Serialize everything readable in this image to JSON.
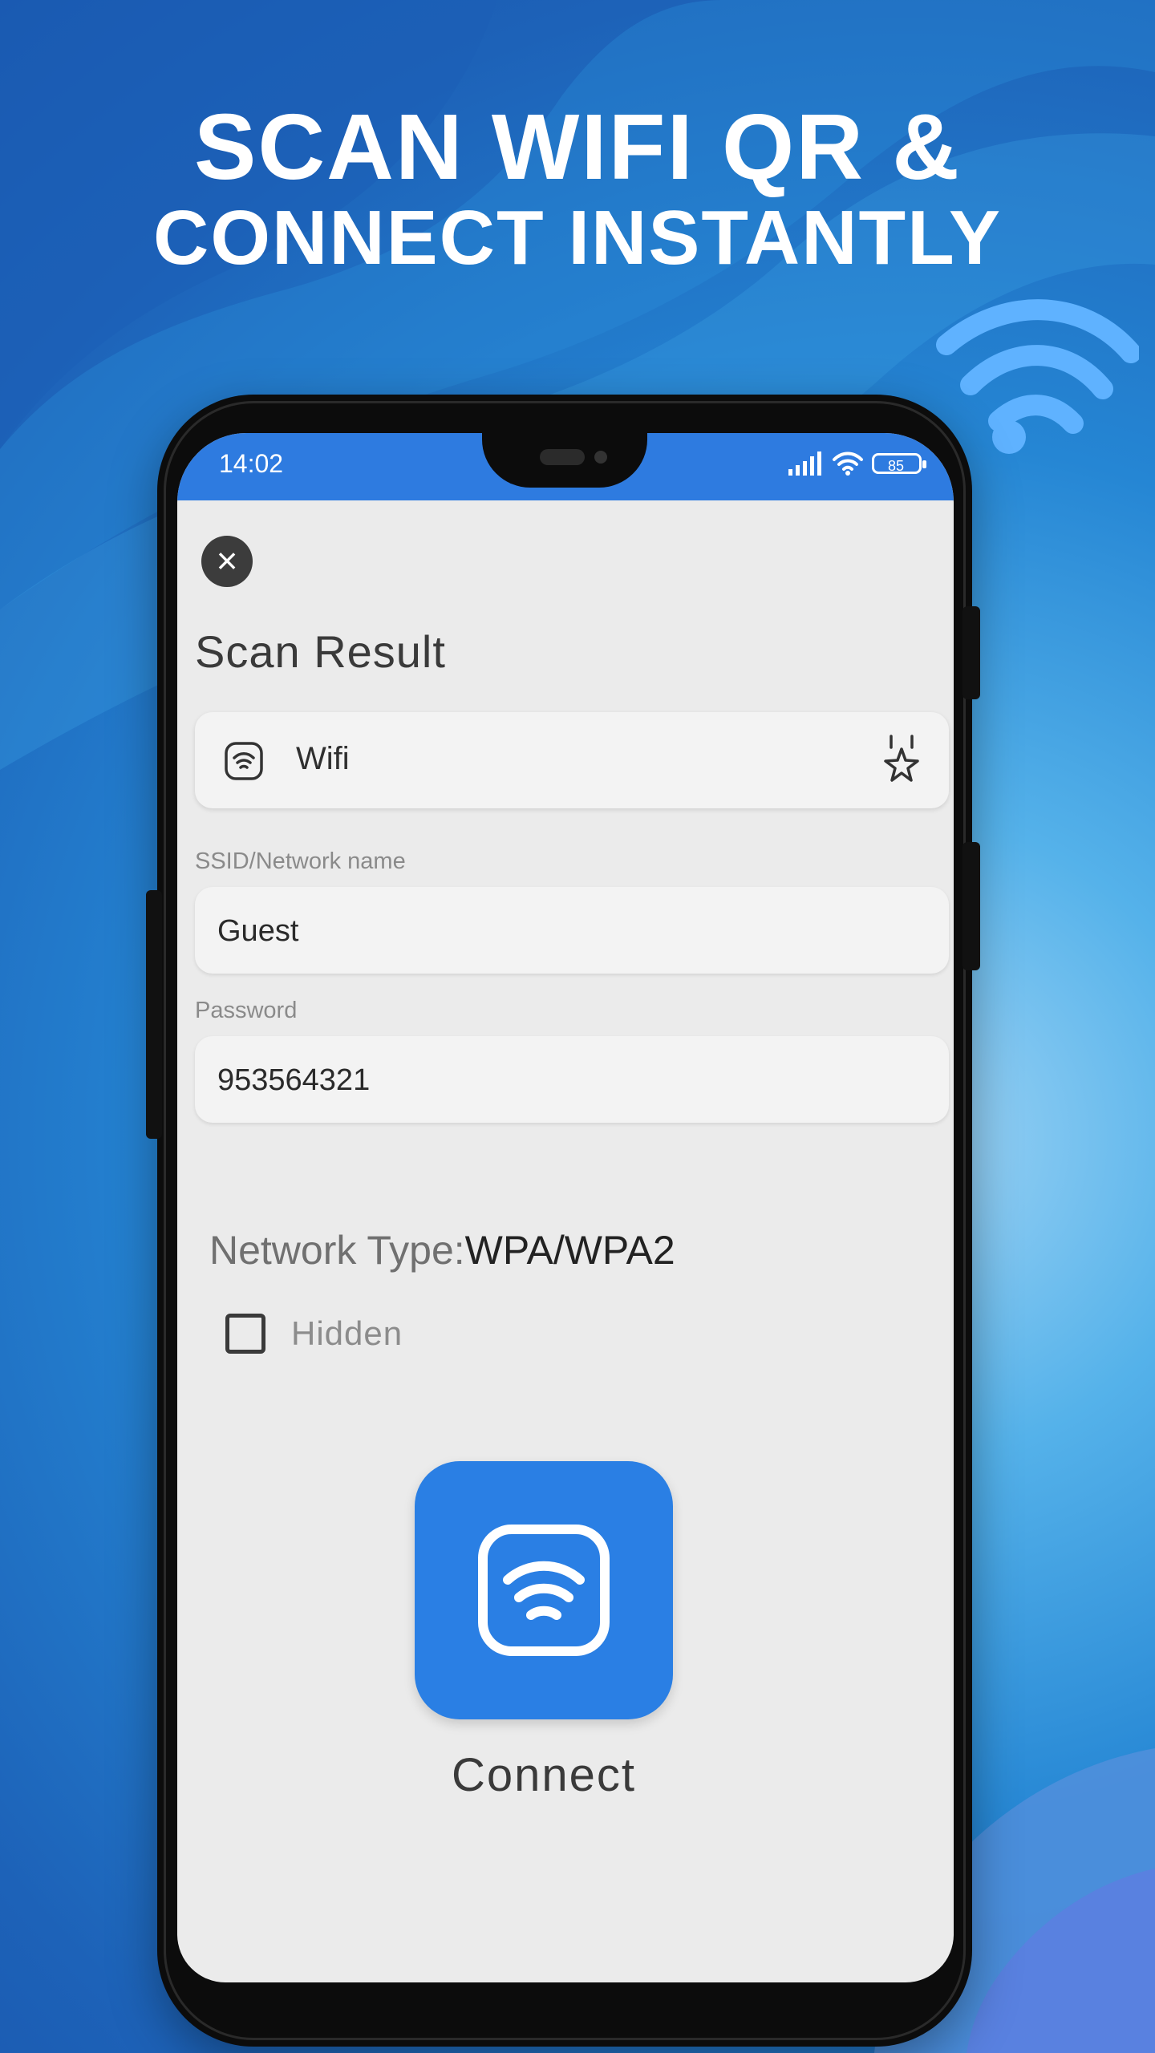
{
  "headline": {
    "line1": "SCAN WIFI QR &",
    "line2": "CONNECT INSTANTLY"
  },
  "statusbar": {
    "time": "14:02",
    "battery": "85"
  },
  "scan": {
    "title": "Scan Result",
    "type_label": "Wifi",
    "ssid_label": "SSID/Network name",
    "ssid_value": "Guest",
    "password_label": "Password",
    "password_value": "953564321",
    "network_type_key": "Network Type:",
    "network_type_value": "WPA/WPA2",
    "hidden_label": "Hidden",
    "connect_label": "Connect"
  },
  "colors": {
    "accent": "#2a7fe4",
    "statusbar": "#2e7be0",
    "screen_bg": "#ebebeb"
  },
  "icons": [
    "wifi-decoration-icon",
    "signal-icon",
    "wifi-status-icon",
    "battery-icon",
    "close-icon",
    "wifi-type-icon",
    "favorite-star-icon",
    "checkbox-icon",
    "wifi-connect-icon"
  ]
}
